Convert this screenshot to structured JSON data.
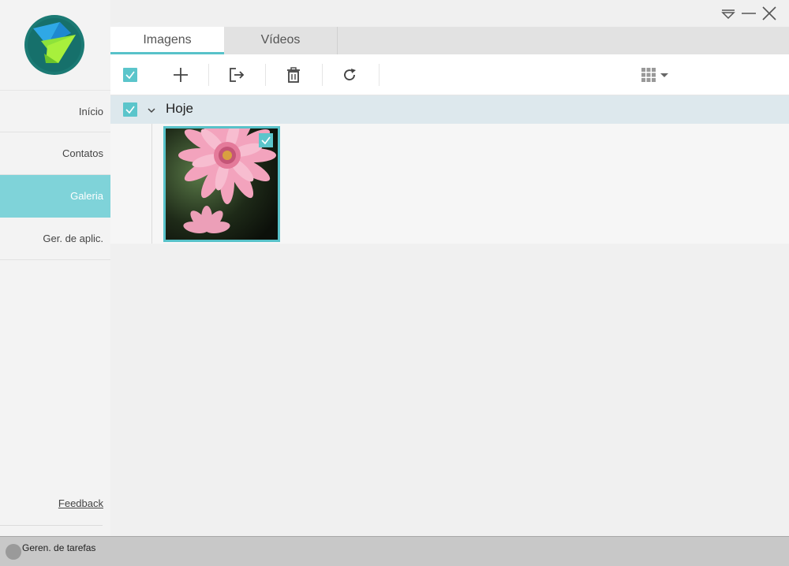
{
  "sidebar": {
    "items": [
      {
        "label": "Início",
        "active": false
      },
      {
        "label": "Contatos",
        "active": false
      },
      {
        "label": "Galeria",
        "active": true
      },
      {
        "label": "Ger. de aplic.",
        "active": false
      }
    ],
    "feedback_label": "Feedback"
  },
  "tabs": [
    {
      "label": "Imagens",
      "active": true
    },
    {
      "label": "Vídeos",
      "active": false
    }
  ],
  "toolbar": {
    "icons": [
      "select-all-checkbox",
      "plus-icon",
      "export-icon",
      "trash-icon",
      "refresh-icon",
      "grid-view-icon"
    ]
  },
  "group": {
    "title": "Hoje",
    "checked": true
  },
  "gallery": {
    "items": [
      {
        "type": "image",
        "subject": "pink flower",
        "checked": true
      }
    ]
  },
  "statusbar": {
    "text": "Geren. de tarefas"
  },
  "colors": {
    "accent": "#58c2c9",
    "active_nav": "#7fd3d9",
    "group_header": "#dde8ed"
  }
}
